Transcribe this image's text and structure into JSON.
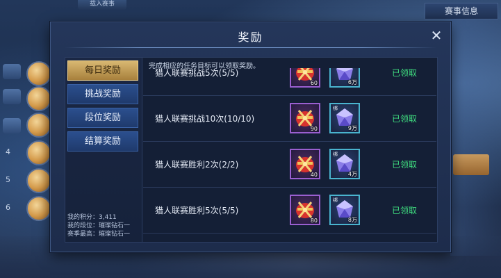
{
  "background": {
    "top_tab_label": "载入赛事",
    "top_right_label": "赛事信息",
    "ranks": [
      "4",
      "5",
      "6"
    ]
  },
  "modal": {
    "title": "奖励",
    "close_icon": "close-icon",
    "hint": "完成相应的任务目标可以领取奖励。",
    "tabs": [
      {
        "label": "每日奖励",
        "active": true
      },
      {
        "label": "挑战奖励",
        "active": false
      },
      {
        "label": "段位奖励",
        "active": false
      },
      {
        "label": "结算奖励",
        "active": false
      }
    ],
    "stats": {
      "score_label": "我的积分：",
      "score_value": "3,411",
      "rank_label": "我的段位：",
      "rank_value": "璀璨钻石一",
      "best_label": "赛季最高：",
      "best_value": "璀璨钻石一"
    },
    "rows": [
      {
        "name": "猎人联赛挑战5次(5/5)",
        "chest_count": "60",
        "gem_tag": "",
        "gem_count": "6万",
        "status": "已领取"
      },
      {
        "name": "猎人联赛挑战10次(10/10)",
        "chest_count": "90",
        "gem_tag": "绑",
        "gem_count": "9万",
        "status": "已领取"
      },
      {
        "name": "猎人联赛胜利2次(2/2)",
        "chest_count": "40",
        "gem_tag": "绑",
        "gem_count": "4万",
        "status": "已领取"
      },
      {
        "name": "猎人联赛胜利5次(5/5)",
        "chest_count": "80",
        "gem_tag": "绑",
        "gem_count": "8万",
        "status": "已领取"
      }
    ]
  }
}
